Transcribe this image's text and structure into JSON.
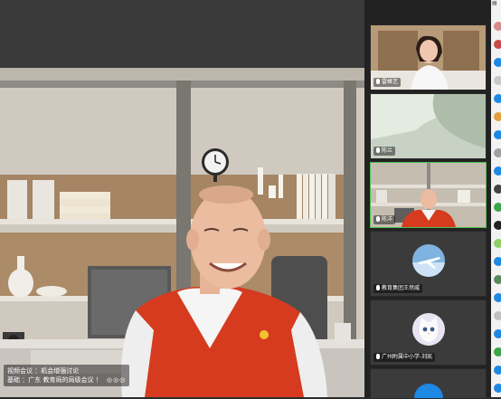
{
  "main": {
    "speaker_line1": "视频会议 ：机会增强讨论",
    "speaker_line2": "基础 ：广东 教育局的局级会议 ！",
    "controls": "◎◎◎"
  },
  "gallery": {
    "tiles": [
      {
        "name": "雷蜂艺",
        "active": false
      },
      {
        "name": "陈兰",
        "active": false
      },
      {
        "name": "陈洋",
        "active": true
      },
      {
        "name": "教育集团王然威",
        "active": false
      },
      {
        "name": "广州附属中小学-刘凯",
        "active": false
      }
    ]
  },
  "colors": {
    "active_border": "#4ec04e",
    "vest_red": "#d63b1f",
    "strip_blue": "#1e88e5"
  },
  "icons": [
    "mic-icon",
    "camera-icon",
    "plane-avatar-icon",
    "cat-avatar-icon"
  ]
}
